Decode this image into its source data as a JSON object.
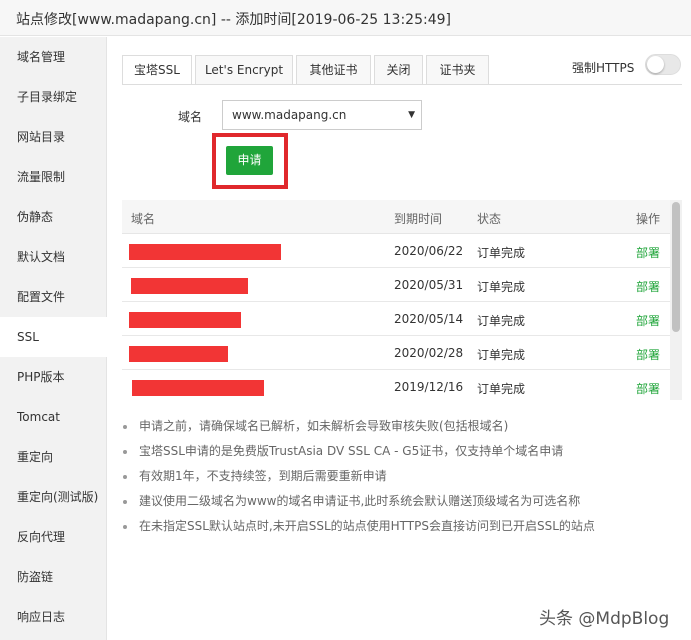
{
  "window": {
    "title": "站点修改[www.madapang.cn] -- 添加时间[2019-06-25 13:25:49]"
  },
  "sidebar": {
    "items": [
      {
        "label": "域名管理"
      },
      {
        "label": "子目录绑定"
      },
      {
        "label": "网站目录"
      },
      {
        "label": "流量限制"
      },
      {
        "label": "伪静态"
      },
      {
        "label": "默认文档"
      },
      {
        "label": "配置文件"
      },
      {
        "label": "SSL",
        "active": true
      },
      {
        "label": "PHP版本"
      },
      {
        "label": "Tomcat"
      },
      {
        "label": "重定向"
      },
      {
        "label": "重定向(测试版)"
      },
      {
        "label": "反向代理"
      },
      {
        "label": "防盗链"
      },
      {
        "label": "响应日志"
      }
    ]
  },
  "tabs": [
    {
      "label": "宝塔SSL",
      "active": true
    },
    {
      "label": "Let's Encrypt"
    },
    {
      "label": "其他证书"
    },
    {
      "label": "关闭"
    },
    {
      "label": "证书夹"
    }
  ],
  "force_https": {
    "label": "强制HTTPS",
    "enabled": false
  },
  "form": {
    "domain_label": "域名",
    "domain_value": "www.madapang.cn",
    "apply_label": "申请"
  },
  "table": {
    "headers": {
      "domain": "域名",
      "expiry": "到期时间",
      "status": "状态",
      "action": "操作"
    },
    "rows": [
      {
        "expiry": "2020/06/22",
        "status": "订单完成",
        "action": "部署"
      },
      {
        "expiry": "2020/05/31",
        "status": "订单完成",
        "action": "部署"
      },
      {
        "expiry": "2020/05/14",
        "status": "订单完成",
        "action": "部署"
      },
      {
        "expiry": "2020/02/28",
        "status": "订单完成",
        "action": "部署"
      },
      {
        "expiry": "2019/12/16",
        "status": "订单完成",
        "action": "部署"
      }
    ]
  },
  "notes": [
    "申请之前，请确保域名已解析，如未解析会导致审核失败(包括根域名)",
    "宝塔SSL申请的是免费版TrustAsia DV SSL CA - G5证书，仅支持单个域名申请",
    "有效期1年，不支持续签，到期后需要重新申请",
    "建议使用二级域名为www的域名申请证书,此时系统会默认赠送顶级域名为可选名称",
    "在未指定SSL默认站点时,未开启SSL的站点使用HTTPS会直接访问到已开启SSL的站点"
  ],
  "watermark": "头条 @MdpBlog",
  "colors": {
    "primary_green": "#20a53a",
    "redaction_red": "#f23535",
    "highlight_red": "#e0282c"
  }
}
